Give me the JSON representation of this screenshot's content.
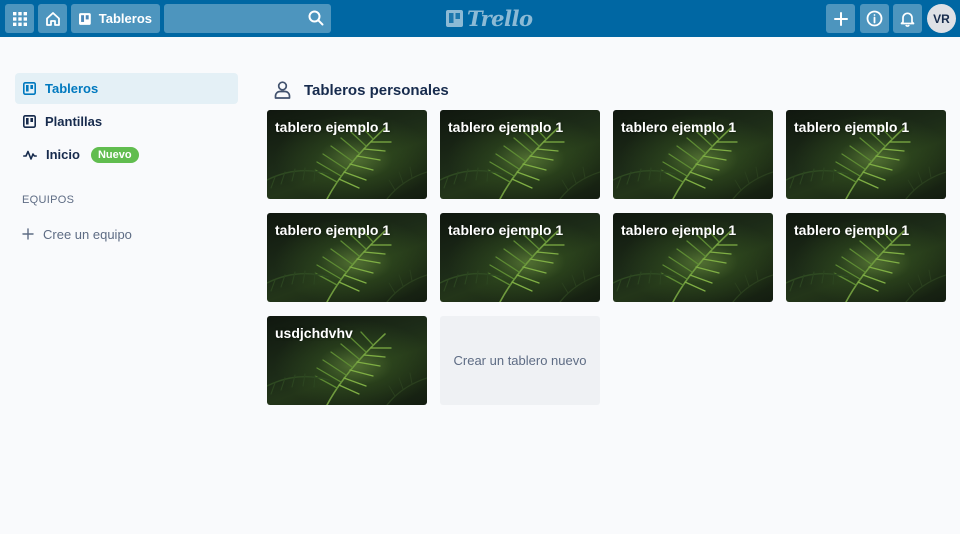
{
  "header": {
    "boards_label": "Tableros",
    "search": {
      "value": "",
      "placeholder": ""
    },
    "logo_text": "Trello",
    "avatar_initials": "VR",
    "icons": [
      "apps-grid-icon",
      "home-icon",
      "boards-icon",
      "search-icon",
      "plus-icon",
      "info-icon",
      "bell-icon"
    ],
    "colors": {
      "bar": "#0067a3",
      "accent": "#0079bf"
    }
  },
  "sidebar": {
    "items": [
      {
        "label": "Tableros",
        "icon": "boards-icon",
        "active": true
      },
      {
        "label": "Plantillas",
        "icon": "templates-icon",
        "active": false
      },
      {
        "label": "Inicio",
        "icon": "activity-icon",
        "active": false,
        "badge": "Nuevo"
      }
    ],
    "teams_title": "EQUIPOS",
    "create_team_label": "Cree un equipo"
  },
  "main": {
    "section_title": "Tableros personales",
    "boards": [
      {
        "title": "tablero ejemplo 1"
      },
      {
        "title": "tablero ejemplo 1"
      },
      {
        "title": "tablero ejemplo 1"
      },
      {
        "title": "tablero ejemplo 1"
      },
      {
        "title": "tablero ejemplo 1"
      },
      {
        "title": "tablero ejemplo 1"
      },
      {
        "title": "tablero ejemplo 1"
      },
      {
        "title": "tablero ejemplo 1"
      },
      {
        "title": "usdjchdvhv"
      }
    ],
    "create_board_label": "Crear un tablero nuevo"
  }
}
